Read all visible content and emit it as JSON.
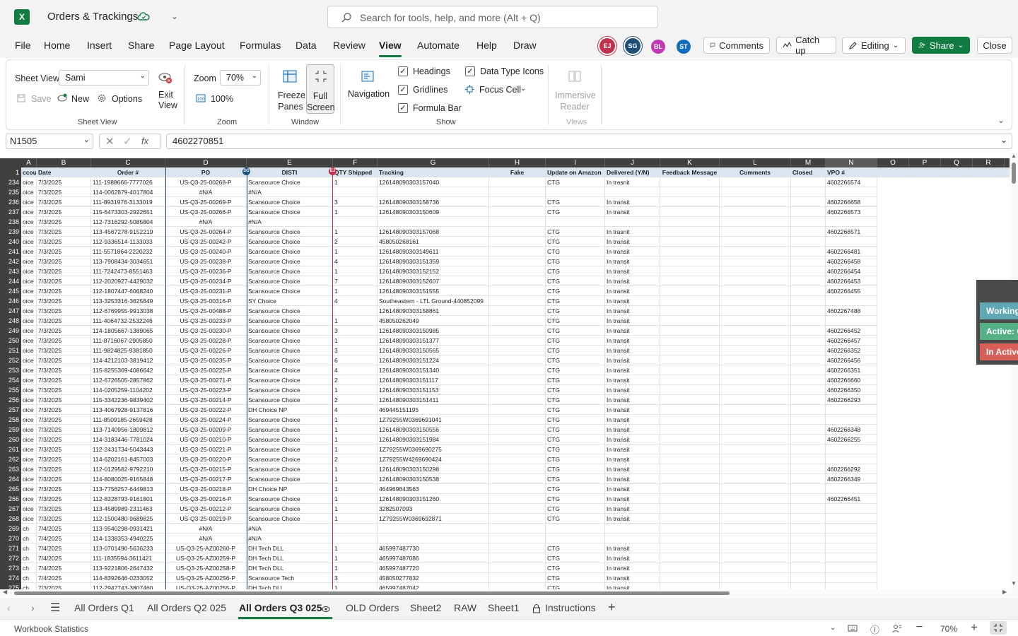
{
  "app": {
    "logo": "X",
    "title": "Orders & Trackings"
  },
  "search": {
    "placeholder": "Search for tools, help, and more (Alt + Q)"
  },
  "menu": [
    "File",
    "Home",
    "Insert",
    "Share",
    "Page Layout",
    "Formulas",
    "Data",
    "Review",
    "View",
    "Automate",
    "Help",
    "Draw"
  ],
  "menu_active": "View",
  "collaborators": [
    {
      "initials": "EJ",
      "color": "#c4314b"
    },
    {
      "initials": "SG",
      "color": "#1f4e79"
    },
    {
      "initials": "BL",
      "color": "#c239b3"
    },
    {
      "initials": "ST",
      "color": "#0f6cbd"
    }
  ],
  "header_buttons": {
    "comments": "Comments",
    "catchup": "Catch up",
    "editing": "Editing",
    "share": "Share",
    "close": "Close"
  },
  "ribbon": {
    "sheet_view_label": "Sheet View",
    "sheet_view_value": "Sami",
    "exit_view": "Exit View",
    "save": "Save",
    "new": "New",
    "options": "Options",
    "group_sheet_view": "Sheet View",
    "zoom_label": "Zoom",
    "zoom_value": "70%",
    "zoom_100": "100%",
    "group_zoom": "Zoom",
    "freeze_panes": "Freeze Panes",
    "full_screen": "Full Screen",
    "group_window": "Window",
    "navigation": "Navigation",
    "headings": "Headings",
    "gridlines": "Gridlines",
    "formula_bar": "Formula Bar",
    "data_type_icons": "Data Type Icons",
    "focus_cell": "Focus Cell",
    "group_show": "Show",
    "immersive_reader": "Immersive Reader",
    "group_views": "Views"
  },
  "formula_bar": {
    "name_box": "N1505",
    "value": "4602270851"
  },
  "columns": [
    {
      "letter": "A"
    },
    {
      "letter": "B"
    },
    {
      "letter": "C"
    },
    {
      "letter": "D"
    },
    {
      "letter": "E"
    },
    {
      "letter": "F"
    },
    {
      "letter": "G"
    },
    {
      "letter": "H"
    },
    {
      "letter": "I"
    },
    {
      "letter": "J"
    },
    {
      "letter": "K"
    },
    {
      "letter": "L"
    },
    {
      "letter": "M"
    },
    {
      "letter": "N"
    },
    {
      "letter": "O"
    },
    {
      "letter": "P"
    },
    {
      "letter": "Q"
    },
    {
      "letter": "R"
    }
  ],
  "selected_column": "N",
  "header_row": {
    "num": "1",
    "cells": [
      "ccount",
      "Date",
      "Order #",
      "PO",
      "DISTI",
      "QTY Shipped",
      "Tracking",
      "Fake",
      "Update on Amazon",
      "Delivered (Y/N)",
      "Feedback Message",
      "Comments",
      "Closed",
      "VPO #",
      "",
      "",
      "",
      ""
    ]
  },
  "rows": [
    [
      "234",
      "oice",
      "7/3/2025",
      "111-1988666-7777026",
      "US-Q3-25-00268-P",
      "Scansource Choice",
      "1",
      "126148090303157040",
      "",
      "CTG",
      "In trasnit",
      "",
      "",
      "",
      "4602266574"
    ],
    [
      "235",
      "oice",
      "7/3/2025",
      "114-0062879-4017804",
      "#N/A",
      "#N/A",
      "",
      "",
      "",
      "",
      "",
      "",
      "",
      "",
      ""
    ],
    [
      "236",
      "oice",
      "7/3/2025",
      "111-8931976-3133019",
      "US-Q3-25-00269-P",
      "Scansource Choice",
      "3",
      "126148090303158736",
      "",
      "CTG",
      "In transit",
      "",
      "",
      "",
      "4602266658"
    ],
    [
      "237",
      "oice",
      "7/3/2025",
      "115-6473303-2922651",
      "US-Q3-25-00266-P",
      "Scansource Choice",
      "1",
      "126148090303150609",
      "",
      "CTG",
      "In transit",
      "",
      "",
      "",
      "4602266573"
    ],
    [
      "238",
      "oice",
      "7/3/2025",
      "112-7316292-5085804",
      "#N/A",
      "#N/A",
      "",
      "",
      "",
      "",
      "",
      "",
      "",
      "",
      ""
    ],
    [
      "239",
      "oice",
      "7/3/2025",
      "113-4567278-9152219",
      "US-Q3-25-00264-P",
      "Scansource Choice",
      "1",
      "126148090303157068",
      "",
      "CTG",
      "In trasnit",
      "",
      "",
      "",
      "4602266571"
    ],
    [
      "240",
      "oice",
      "7/3/2025",
      "112-9336514-1133033",
      "US-Q3-25-00242-P",
      "Scansource Choice",
      "2",
      "458050268161",
      "",
      "CTG",
      "In transit",
      "",
      "",
      "",
      ""
    ],
    [
      "241",
      "oice",
      "7/3/2025",
      "111-5571864-2220232",
      "US-Q3-25-00240-P",
      "Scansource Choice",
      "1",
      "126148090303149611",
      "",
      "CTG",
      "In transit",
      "",
      "",
      "",
      "4602266481"
    ],
    [
      "242",
      "oice",
      "7/3/2025",
      "113-7908434-3034651",
      "US-Q3-25-00238-P",
      "Scansource Choice",
      "4",
      "126148090303151359",
      "",
      "CTG",
      "In transit",
      "",
      "",
      "",
      "4602266458"
    ],
    [
      "243",
      "oice",
      "7/3/2025",
      "111-7242473-8551463",
      "US-Q3-25-00236-P",
      "Scansource Choice",
      "1",
      "126148090303152152",
      "",
      "CTG",
      "In transit",
      "",
      "",
      "",
      "4602266454"
    ],
    [
      "244",
      "oice",
      "7/3/2025",
      "112-2020927-4429032",
      "US-Q3-25-00234-P",
      "Scansource Choice",
      "7",
      "126148090303152607",
      "",
      "CTG",
      "In transit",
      "",
      "",
      "",
      "4602266453"
    ],
    [
      "245",
      "oice",
      "7/3/2025",
      "112-1807447-6068240",
      "US-Q3-25-00231-P",
      "Scansource Choice",
      "1",
      "126148090303151555",
      "",
      "CTG",
      "In transit",
      "",
      "",
      "",
      "4602266455"
    ],
    [
      "246",
      "oice",
      "7/3/2025",
      "113-3253316-3625849",
      "US-Q3-25-00316-P",
      "SY Choice",
      "4",
      "Southeastern - LTL Ground-440852099",
      "",
      "CTG",
      "In transit",
      "",
      "",
      "",
      ""
    ],
    [
      "247",
      "oice",
      "7/3/2025",
      "112-6769955-9913038",
      "US-Q3-25-00488-P",
      "Scansource Choice",
      "",
      "126148090303158861",
      "",
      "CTG",
      "In transit",
      "",
      "",
      "",
      "4602267488"
    ],
    [
      "248",
      "oice",
      "7/3/2025",
      "111-4064732-2532246",
      "US-Q3-25-00233-P",
      "Scansource Choice",
      "1",
      "458050262049",
      "",
      "CTG",
      "In transit",
      "",
      "",
      "",
      ""
    ],
    [
      "249",
      "oice",
      "7/3/2025",
      "114-1805667-1389065",
      "US-Q3-25-00230-P",
      "Scansource Choice",
      "3",
      "126148090303150985",
      "",
      "CTG",
      "In transit",
      "",
      "",
      "",
      "4602266452"
    ],
    [
      "250",
      "oice",
      "7/3/2025",
      "111-8716067-2905850",
      "US-Q3-25-00228-P",
      "Scansource Choice",
      "1",
      "126148090303151377",
      "",
      "CTG",
      "In transit",
      "",
      "",
      "",
      "4602266457"
    ],
    [
      "251",
      "oice",
      "7/3/2025",
      "111-9824825-9381850",
      "US-Q3-25-00226-P",
      "Scansource Choice",
      "3",
      "126148090303150565",
      "",
      "CTG",
      "In transit",
      "",
      "",
      "",
      "4602266352"
    ],
    [
      "252",
      "oice",
      "7/3/2025",
      "114-4212103-3819412",
      "US-Q3-25-00235-P",
      "Scansource Choice",
      "6",
      "126148090303151224",
      "",
      "CTG",
      "In transit",
      "",
      "",
      "",
      "4602266456"
    ],
    [
      "253",
      "oice",
      "7/3/2025",
      "115-8255369-4086642",
      "US-Q3-25-00225-P",
      "Scansource Choice",
      "4",
      "126148090303151340",
      "",
      "CTG",
      "In transit",
      "",
      "",
      "",
      "4602266351"
    ],
    [
      "254",
      "oice",
      "7/3/2025",
      "112-6726505-2857862",
      "US-Q3-25-00271-P",
      "Scansource Choice",
      "2",
      "126148090303151117",
      "",
      "CTG",
      "In transit",
      "",
      "",
      "",
      "4602266660"
    ],
    [
      "255",
      "oice",
      "7/3/2025",
      "114-0205259-1104202",
      "US-Q3-25-00223-P",
      "Scansource Choice",
      "1",
      "126148090303151153",
      "",
      "CTG",
      "In transit",
      "",
      "",
      "",
      "4602266350"
    ],
    [
      "256",
      "oice",
      "7/3/2025",
      "115-3342236-9839402",
      "US-Q3-25-00214-P",
      "Scansource Choice",
      "2",
      "126148090303151411",
      "",
      "CTG",
      "In transit",
      "",
      "",
      "",
      "4602266293"
    ],
    [
      "257",
      "oice",
      "7/3/2025",
      "113-4067928-9137816",
      "US-Q3-25-00222-P",
      "DH Choice NP",
      "4",
      "469445151195",
      "",
      "CTG",
      "In transit",
      "",
      "",
      "",
      ""
    ],
    [
      "258",
      "oice",
      "7/3/2025",
      "111-8509185-2659428",
      "US-Q3-25-00224-P",
      "Scansource Choice",
      "1",
      "1Z79255W0369691041",
      "",
      "CTG",
      "In transit",
      "",
      "",
      "",
      ""
    ],
    [
      "259",
      "oice",
      "7/3/2025",
      "113-7140956-1809812",
      "US-Q3-25-00209-P",
      "Scansource Choice",
      "1",
      "126148090303150556",
      "",
      "CTG",
      "In transit",
      "",
      "",
      "",
      "4602266348"
    ],
    [
      "260",
      "oice",
      "7/3/2025",
      "114-3183446-7781024",
      "US-Q3-25-00210-P",
      "Scansource Choice",
      "1",
      "126148090303151984",
      "",
      "CTG",
      "In transit",
      "",
      "",
      "",
      "4602266255"
    ],
    [
      "261",
      "oice",
      "7/3/2025",
      "112-2431734-5043443",
      "US-Q3-25-00221-P",
      "Scansource Choice",
      "1",
      "1Z79255W0369690275",
      "",
      "CTG",
      "In transit",
      "",
      "",
      "",
      ""
    ],
    [
      "262",
      "oice",
      "7/3/2025",
      "114-6202161-8457003",
      "US-Q3-25-00220-P",
      "Scansource Choice",
      "2",
      "1Z79255W4269690424",
      "",
      "CTG",
      "In transit",
      "",
      "",
      "",
      ""
    ],
    [
      "263",
      "oice",
      "7/3/2025",
      "112-0129582-9792210",
      "US-Q3-25-00215-P",
      "Scansource Choice",
      "1",
      "126148090303150298",
      "",
      "CTG",
      "In transit",
      "",
      "",
      "",
      "4602266292"
    ],
    [
      "264",
      "oice",
      "7/3/2025",
      "114-8080025-9165848",
      "US-Q3-25-00217-P",
      "Scansource Choice",
      "1",
      "126148090303150538",
      "",
      "CTG",
      "In transit",
      "",
      "",
      "",
      "4602266349"
    ],
    [
      "265",
      "oice",
      "7/3/2025",
      "113-7756257-6449813",
      "US-Q3-25-00218-P",
      "DH Choice NP",
      "1",
      "464969843563",
      "",
      "CTG",
      "In transit",
      "",
      "",
      "",
      ""
    ],
    [
      "266",
      "oice",
      "7/3/2025",
      "112-8328793-9161801",
      "US-Q3-25-00216-P",
      "Scansource Choice",
      "1",
      "126148090303151260",
      "",
      "CTG",
      "In transit",
      "",
      "",
      "",
      "4602266451"
    ],
    [
      "267",
      "oice",
      "7/3/2025",
      "113-4589989-2311463",
      "US-Q3-25-00212-P",
      "Scansource Choice",
      "1",
      "3282507093",
      "",
      "CTG",
      "In transit",
      "",
      "",
      "",
      ""
    ],
    [
      "268",
      "oice",
      "7/3/2025",
      "112-1500480-9689825",
      "US-Q3-25-00219-P",
      "Scansource Choice",
      "1",
      "1Z79255W0369692871",
      "",
      "CTG",
      "In transit",
      "",
      "",
      "",
      ""
    ],
    [
      "269",
      "ch",
      "7/4/2025",
      "113-9540298-0931421",
      "#N/A",
      "#N/A",
      "",
      "",
      "",
      "",
      "",
      "",
      "",
      "",
      ""
    ],
    [
      "270",
      "ch",
      "7/4/2025",
      "114-1338353-4940225",
      "#N/A",
      "#N/A",
      "",
      "",
      "",
      "",
      "",
      "",
      "",
      "",
      ""
    ],
    [
      "271",
      "ch",
      "7/4/2025",
      "113-0701490-5636233",
      "US-Q3-25-AZ00260-P",
      "DH Tech DLL",
      "1",
      "465997487730",
      "",
      "CTG",
      "In transit",
      "",
      "",
      "",
      ""
    ],
    [
      "272",
      "ch",
      "7/4/2025",
      "111-1835594-3611421",
      "US-Q3-25-AZ00259-P",
      "DH Tech DLL",
      "1",
      "465997487086",
      "",
      "CTG",
      "In transit",
      "",
      "",
      "",
      ""
    ],
    [
      "273",
      "ch",
      "7/4/2025",
      "113-9221806-2647432",
      "US-Q3-25-AZ00258-P",
      "DH Tech DLL",
      "1",
      "465997487720",
      "",
      "CTG",
      "In transit",
      "",
      "",
      "",
      ""
    ],
    [
      "274",
      "ch",
      "7/4/2025",
      "114-8392646-0233052",
      "US-Q3-25-AZ00256-P",
      "Scansource Tech",
      "3",
      "458050277832",
      "",
      "CTG",
      "In transit",
      "",
      "",
      "",
      ""
    ],
    [
      "275",
      "ch",
      "7/3/2025",
      "112-2947743-3807460",
      "US-Q3-25-AZ00255-P",
      "DH Tech DLL",
      "1",
      "465997487042",
      "",
      "CTG",
      "In transit",
      "",
      "",
      "",
      ""
    ]
  ],
  "side_panel": [
    {
      "label": "Working",
      "color": "#5fa8b4"
    },
    {
      "label": "Active: C",
      "color": "#55b087"
    },
    {
      "label": "In Active",
      "color": "#d9605a"
    }
  ],
  "sheet_tabs": [
    "All Orders Q1",
    "All Orders Q2 025",
    "All Orders Q3 025",
    "OLD Orders",
    "Sheet2",
    "RAW",
    "Sheet1",
    "Instructions"
  ],
  "active_tab": "All Orders Q3 025",
  "status": {
    "left": "Workbook Statistics",
    "zoom": "70%"
  }
}
